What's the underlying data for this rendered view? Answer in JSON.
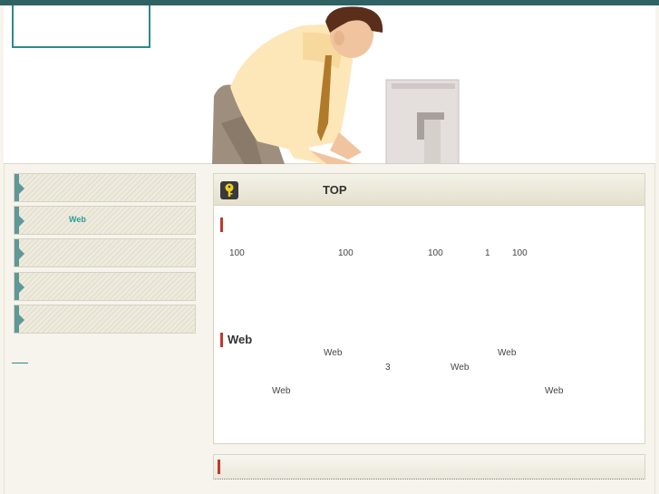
{
  "colors": {
    "topbar": "#2e6263",
    "accent": "#2e8a8a",
    "nav_marker": "#5f9898",
    "section_marker": "#c0392b"
  },
  "header": {
    "logo_text": ""
  },
  "sidebar": {
    "items": [
      {
        "label": ""
      },
      {
        "label": "Web"
      },
      {
        "label": ""
      },
      {
        "label": ""
      },
      {
        "label": ""
      }
    ],
    "link_text": ""
  },
  "main": {
    "panel_title": "TOP",
    "panel_icon": "key-icon",
    "section1": {
      "title": "",
      "numbers": [
        "100",
        "100",
        "100",
        "1",
        "100"
      ]
    },
    "section2": {
      "title": "Web",
      "line1": [
        "Web",
        "Web"
      ],
      "line2": [
        "3",
        "Web"
      ],
      "line3": [
        "Web",
        "Web"
      ]
    },
    "bottom_title": ""
  }
}
